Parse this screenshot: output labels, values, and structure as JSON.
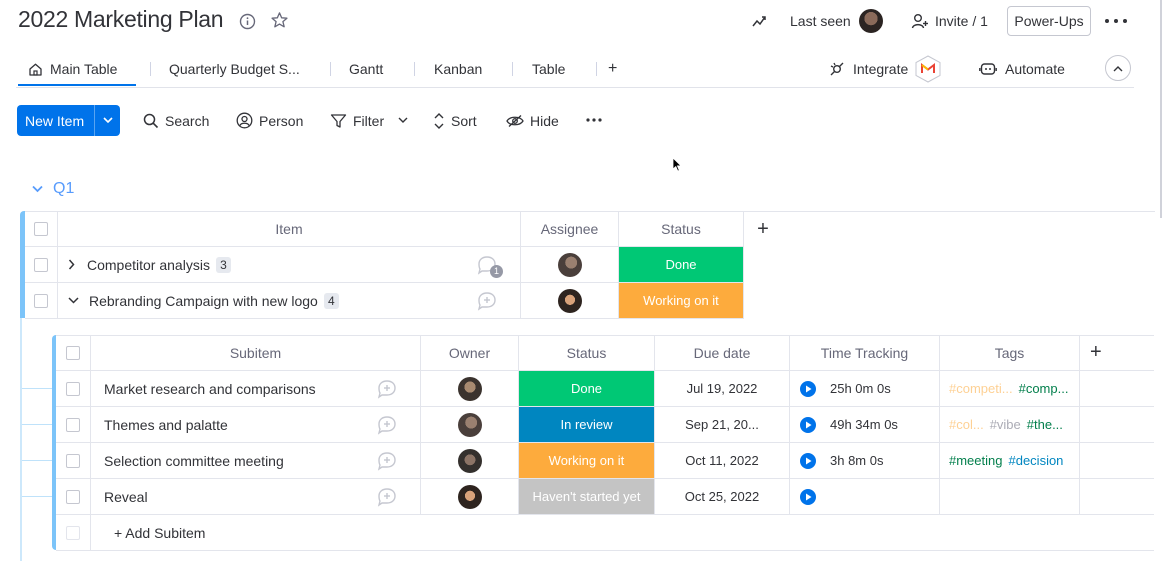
{
  "header": {
    "title": "2022 Marketing Plan",
    "last_seen_label": "Last seen",
    "invite_label": "Invite / 1",
    "powerups_label": "Power-Ups"
  },
  "tabs": [
    {
      "label": "Main Table",
      "active": true
    },
    {
      "label": "Quarterly Budget S..."
    },
    {
      "label": "Gantt"
    },
    {
      "label": "Kanban"
    },
    {
      "label": "Table"
    },
    {
      "label": "+"
    }
  ],
  "tab_actions": {
    "integrate_label": "Integrate",
    "automate_label": "Automate"
  },
  "toolbar": {
    "new_item_label": "New Item",
    "search_label": "Search",
    "person_label": "Person",
    "filter_label": "Filter",
    "sort_label": "Sort",
    "hide_label": "Hide"
  },
  "group": {
    "title": "Q1",
    "color": "#579bfc",
    "columns": {
      "item": "Item",
      "assignee": "Assignee",
      "status": "Status",
      "add": "+"
    },
    "items": [
      {
        "name": "Competitor analysis",
        "count": "3",
        "status": "Done",
        "status_color": "#00c875",
        "updates": "1"
      },
      {
        "name": "Rebranding Campaign with new logo",
        "count": "4",
        "status": "Working on it",
        "status_color": "#fdab3d"
      }
    ]
  },
  "subitems": {
    "columns": {
      "subitem": "Subitem",
      "owner": "Owner",
      "status": "Status",
      "due_date": "Due date",
      "time_tracking": "Time Tracking",
      "tags": "Tags",
      "add": "+"
    },
    "rows": [
      {
        "name": "Market research and comparisons",
        "status": "Done",
        "status_color": "#00c875",
        "due": "Jul 19, 2022",
        "time": "25h 0m 0s",
        "tags": [
          {
            "text": "#competi...",
            "color": "#fdab3d",
            "faded": true
          },
          {
            "text": "#comp...",
            "color": "#037f4c"
          }
        ]
      },
      {
        "name": "Themes and palatte",
        "status": "In review",
        "status_color": "#0086c0",
        "due": "Sep 21, 20...",
        "time": "49h 34m 0s",
        "tags": [
          {
            "text": "#col...",
            "color": "#fdab3d",
            "faded": true
          },
          {
            "text": "#vibe",
            "color": "#676879",
            "faded": true
          },
          {
            "text": "#the...",
            "color": "#037f4c"
          }
        ]
      },
      {
        "name": "Selection committee meeting",
        "status": "Working on it",
        "status_color": "#fdab3d",
        "due": "Oct 11, 2022",
        "time": "3h 8m 0s",
        "tags": [
          {
            "text": "#meeting",
            "color": "#037f4c"
          },
          {
            "text": "#decision",
            "color": "#0086c0"
          }
        ]
      },
      {
        "name": "Reveal",
        "status": "Haven't started yet",
        "status_color": "#c4c4c4",
        "due": "Oct 25, 2022",
        "time": "",
        "tags": []
      }
    ],
    "add_label": "+ Add Subitem"
  },
  "icons": {
    "info": "info-icon",
    "star": "star-icon",
    "activity": "activity-icon",
    "person_add": "person-add-icon",
    "more": "more-dots-icon",
    "home": "home-icon",
    "integrate": "integrate-icon",
    "automate": "robot-icon",
    "collapse": "chevron-up-icon",
    "search": "search-icon",
    "person": "person-icon",
    "filter": "filter-icon",
    "sort": "sort-icon",
    "hide": "eye-icon",
    "chat": "chat-bubble-icon",
    "play": "play-icon"
  }
}
